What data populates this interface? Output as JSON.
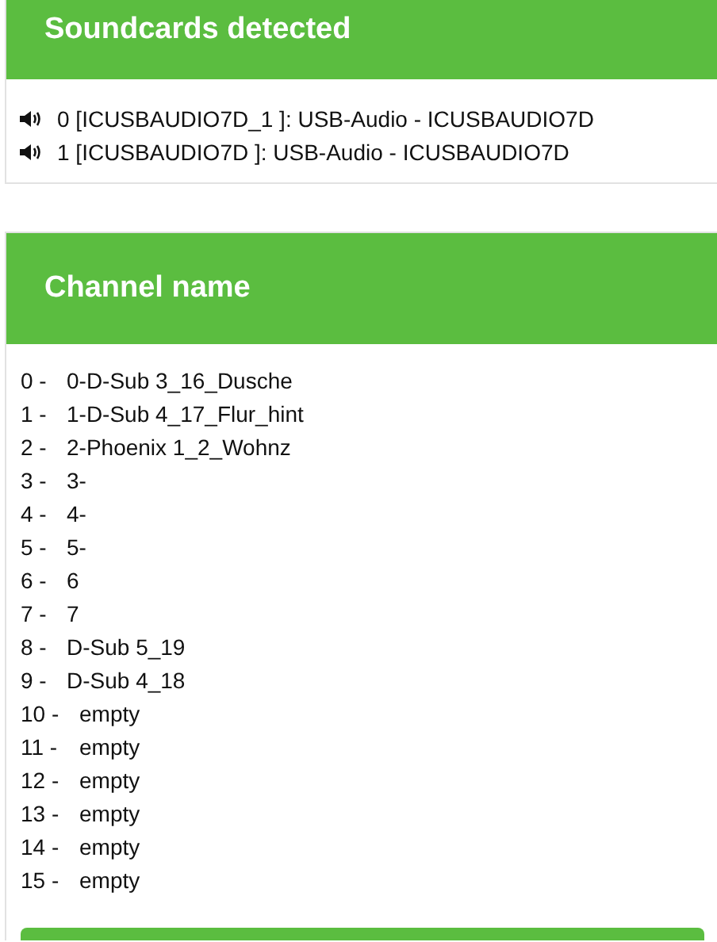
{
  "soundcards": {
    "title": "Soundcards detected",
    "items": [
      {
        "text": "0 [ICUSBAUDIO7D_1 ]: USB-Audio - ICUSBAUDIO7D"
      },
      {
        "text": "1 [ICUSBAUDIO7D ]: USB-Audio - ICUSBAUDIO7D"
      }
    ]
  },
  "channels": {
    "title": "Channel name",
    "items": [
      {
        "index": "0 -",
        "name": "0-D-Sub 3_16_Dusche"
      },
      {
        "index": "1 -",
        "name": "1-D-Sub 4_17_Flur_hint"
      },
      {
        "index": "2 -",
        "name": "2-Phoenix 1_2_Wohnz"
      },
      {
        "index": "3 -",
        "name": "3-"
      },
      {
        "index": "4 -",
        "name": "4-"
      },
      {
        "index": "5 -",
        "name": "5-"
      },
      {
        "index": "6 -",
        "name": "6"
      },
      {
        "index": "7 -",
        "name": "7"
      },
      {
        "index": "8 -",
        "name": "D-Sub 5_19"
      },
      {
        "index": "9 -",
        "name": "D-Sub 4_18"
      },
      {
        "index": "10 -",
        "name": "empty"
      },
      {
        "index": "11 -",
        "name": "empty"
      },
      {
        "index": "12 -",
        "name": "empty"
      },
      {
        "index": "13 -",
        "name": "empty"
      },
      {
        "index": "14 -",
        "name": "empty"
      },
      {
        "index": "15 -",
        "name": "empty"
      }
    ]
  }
}
